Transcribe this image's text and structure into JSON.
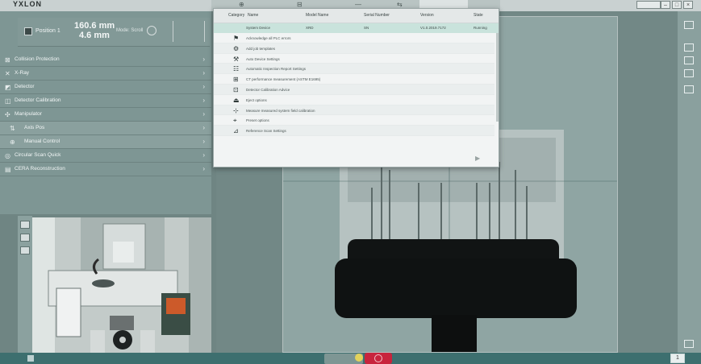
{
  "app": {
    "brand": "YXLON"
  },
  "topbar": {
    "tab_glyphs": [
      "⊕",
      "⊟",
      "—",
      "⇆"
    ],
    "window_buttons": [
      "–",
      "□",
      "×"
    ]
  },
  "left_panel": {
    "position": {
      "label": "Position 1",
      "value1": "160.6 mm",
      "value2": "4.6 mm",
      "mode": "Mode: Scroll"
    },
    "menu": [
      {
        "icon": "collision-icon",
        "glyph": "⊠",
        "label": "Collision Protection",
        "sub": false
      },
      {
        "icon": "xray-icon",
        "glyph": "✕",
        "label": "X-Ray",
        "sub": false
      },
      {
        "icon": "detector-icon",
        "glyph": "◩",
        "label": "Detector",
        "sub": false
      },
      {
        "icon": "calibration-icon",
        "glyph": "◫",
        "label": "Detector Calibration",
        "sub": false
      },
      {
        "icon": "manipulator-icon",
        "glyph": "✣",
        "label": "Manipulator",
        "sub": false
      },
      {
        "icon": "axis-icon",
        "glyph": "⇅",
        "label": "Axis Pos",
        "sub": true
      },
      {
        "icon": "manual-icon",
        "glyph": "⊕",
        "label": "Manual Control",
        "sub": true
      },
      {
        "icon": "circular-scan-icon",
        "glyph": "◎",
        "label": "Circular Scan Quick",
        "sub": false
      },
      {
        "icon": "reconstruction-icon",
        "glyph": "▤",
        "label": "CERA Reconstruction",
        "sub": false
      }
    ]
  },
  "dialog": {
    "headers": [
      "Category",
      "Name",
      "Model Name",
      "Serial Number",
      "Version",
      "State"
    ],
    "first_row": [
      "System Device",
      "XRD",
      "SN",
      "V1.0.2019.7172",
      "Running"
    ],
    "items": [
      {
        "icon": "acknowledge-icon",
        "glyph": "⚑",
        "label": "Acknowledge all PLC errors"
      },
      {
        "icon": "safe-job-icon",
        "glyph": "⚙",
        "label": "Add job templates"
      },
      {
        "icon": "auto-device-icon",
        "glyph": "⚒",
        "label": "Auto Device Settings"
      },
      {
        "icon": "inspection-icon",
        "glyph": "☷",
        "label": "Automatic Inspection Report Settings"
      },
      {
        "icon": "ct-performance-icon",
        "glyph": "⊞",
        "label": "CT performance measurement (ASTM E1695)"
      },
      {
        "icon": "detector-calibration-icon",
        "glyph": "⊡",
        "label": "Detector Calibration Advice"
      },
      {
        "icon": "eject-icon",
        "glyph": "⏏",
        "label": "Eject options"
      },
      {
        "icon": "measure-icon",
        "glyph": "⊹",
        "label": "Measure measured system field calibration"
      },
      {
        "icon": "preset-icon",
        "glyph": "⌖",
        "label": "Preset options"
      },
      {
        "icon": "reference-icon",
        "glyph": "⊿",
        "label": "Reference Scan Settings"
      }
    ],
    "next_glyph": "▶"
  },
  "taskbar": {
    "page": "1"
  }
}
